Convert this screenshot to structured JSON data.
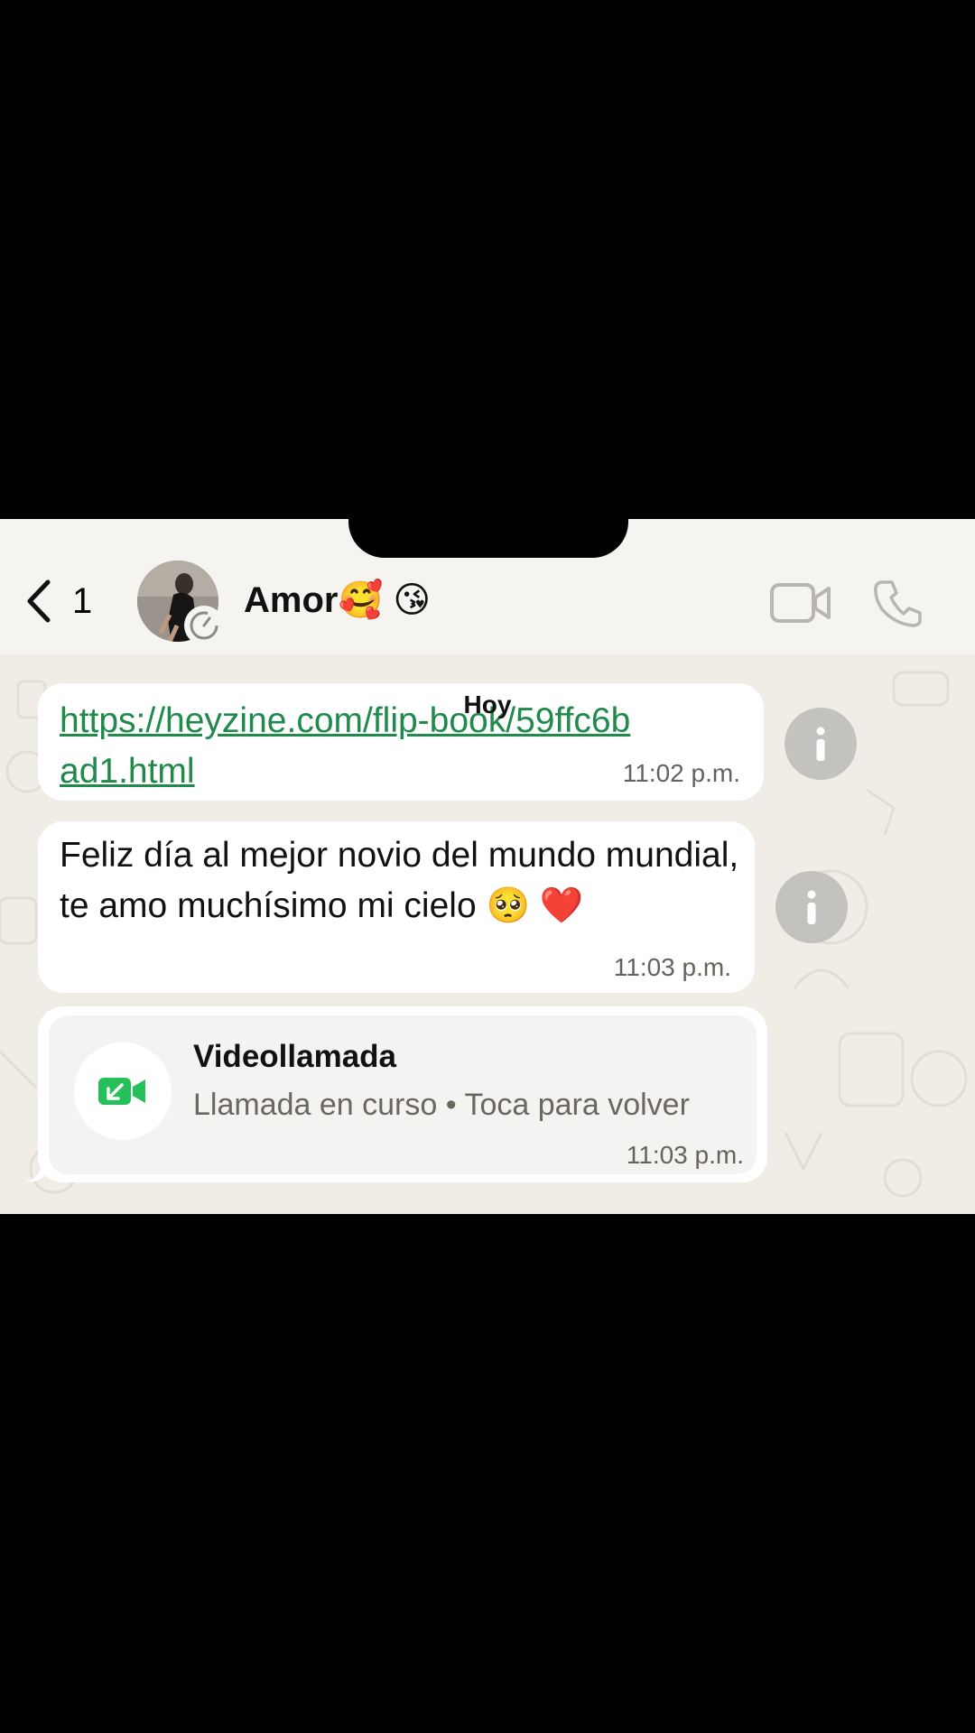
{
  "header": {
    "back_count": "1",
    "contact_name": "Amor🥰 😘",
    "icons": [
      "chevron-left-icon",
      "video-call-icon",
      "phone-icon",
      "status-timer-icon"
    ]
  },
  "chat": {
    "day_label": "Hoy",
    "messages": [
      {
        "type": "link",
        "text": "https://heyzine.com/flip-book/59ffc6bad1.html",
        "time": "11:02 p.m."
      },
      {
        "type": "text",
        "text": "Feliz día al mejor novio del mundo mundial, te amo muchísimo mi cielo 🥺 ❤️",
        "time": "11:03 p.m."
      },
      {
        "type": "call",
        "title": "Videollamada",
        "subtitle": "Llamada en curso • Toca para volver",
        "time": "11:03 p.m."
      }
    ]
  },
  "colors": {
    "link": "#1f8a4a",
    "call_icon": "#25c05a",
    "background": "#f0ede6",
    "info_button": "#c4c2bf"
  }
}
